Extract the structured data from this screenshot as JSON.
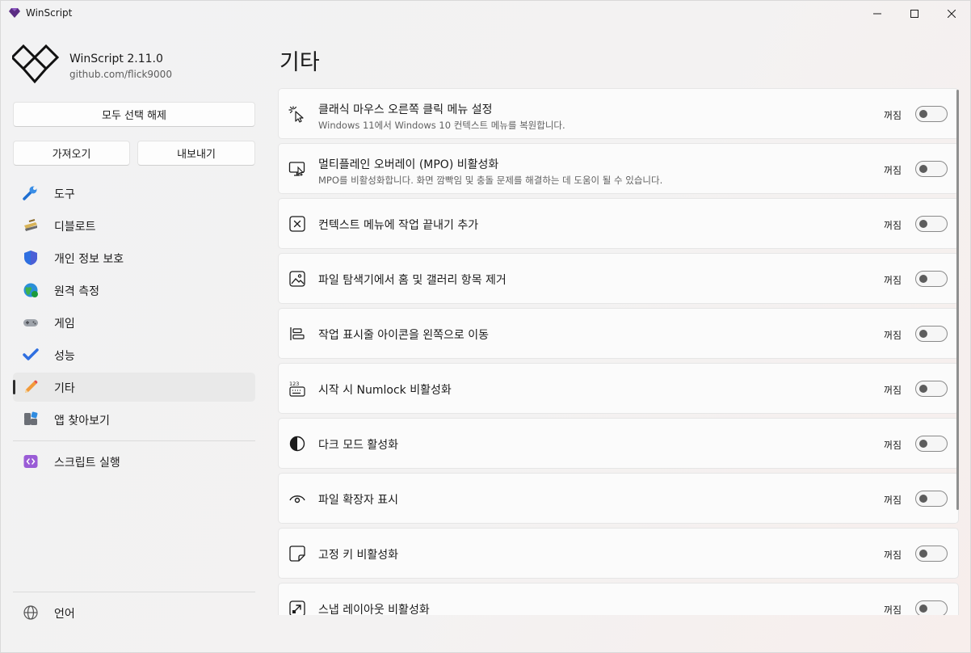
{
  "window": {
    "title": "WinScript"
  },
  "sidebar": {
    "app_name": "WinScript 2.11.0",
    "app_link": "github.com/flick9000",
    "deselect_all": "모두 선택 해제",
    "import": "가져오기",
    "export": "내보내기",
    "items": [
      {
        "label": "도구",
        "icon": "wrench-icon"
      },
      {
        "label": "디블로트",
        "icon": "broom-icon"
      },
      {
        "label": "개인 정보 보호",
        "icon": "shield-icon"
      },
      {
        "label": "원격 측정",
        "icon": "globe-icon"
      },
      {
        "label": "게임",
        "icon": "gamepad-icon"
      },
      {
        "label": "성능",
        "icon": "check-icon"
      },
      {
        "label": "기타",
        "icon": "pencil-icon",
        "selected": true
      },
      {
        "label": "앱 찾아보기",
        "icon": "apps-icon"
      }
    ],
    "run_script": "스크립트 실행",
    "language": "언어"
  },
  "main": {
    "title": "기타",
    "settings": [
      {
        "title": "클래식 마우스 오른쪽 클릭 메뉴 설정",
        "description": "Windows 11에서 Windows 10 컨텍스트 메뉴를 복원합니다.",
        "state": "꺼짐",
        "icon": "cursor-click-icon",
        "on": false
      },
      {
        "title": "멀티플레인 오버레이 (MPO) 비활성화",
        "description": "MPO를 비활성화합니다. 화면 깜빡임 및 충돌 문제를 해결하는 데 도움이 될 수 있습니다.",
        "state": "꺼짐",
        "icon": "monitor-icon",
        "on": false
      },
      {
        "title": "컨텍스트 메뉴에 작업 끝내기 추가",
        "description": "",
        "state": "꺼짐",
        "icon": "close-box-icon",
        "on": false
      },
      {
        "title": "파일 탐색기에서 홈 및 갤러리 항목 제거",
        "description": "",
        "state": "꺼짐",
        "icon": "image-icon",
        "on": false
      },
      {
        "title": "작업 표시줄 아이콘을 왼쪽으로 이동",
        "description": "",
        "state": "꺼짐",
        "icon": "align-left-icon",
        "on": false
      },
      {
        "title": "시작 시 Numlock 비활성화",
        "description": "",
        "state": "꺼짐",
        "icon": "numpad-icon",
        "on": false
      },
      {
        "title": "다크 모드 활성화",
        "description": "",
        "state": "꺼짐",
        "icon": "contrast-icon",
        "on": false
      },
      {
        "title": "파일 확장자 표시",
        "description": "",
        "state": "꺼짐",
        "icon": "eye-icon",
        "on": false
      },
      {
        "title": "고정 키 비활성화",
        "description": "",
        "state": "꺼짐",
        "icon": "sticky-note-icon",
        "on": false
      },
      {
        "title": "스냅 레이아웃 비활성화",
        "description": "",
        "state": "꺼짐",
        "icon": "snap-icon",
        "on": false
      }
    ]
  }
}
